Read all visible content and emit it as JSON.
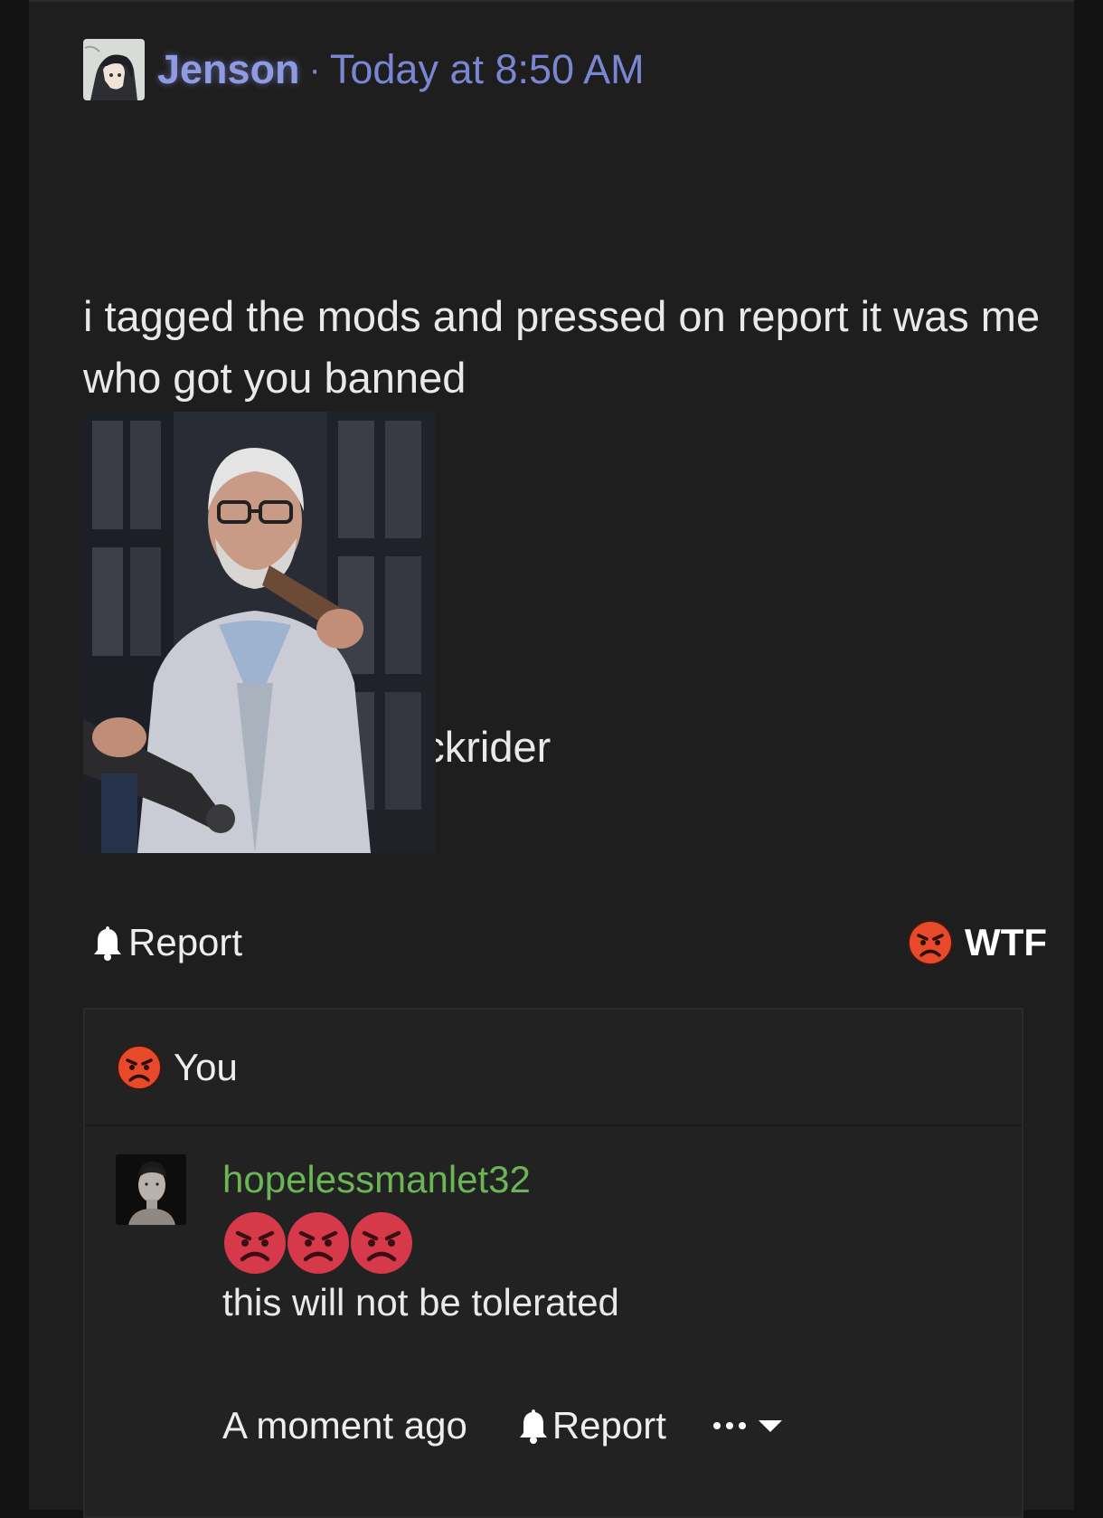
{
  "post": {
    "author": "Jenson",
    "separator": "·",
    "timestamp": "Today at 8:50 AM",
    "body_line1": "i tagged the mods and pressed on report it was me who got you banned",
    "body_line2": "-1 afroheadluke dickrider",
    "avatar_icon": "anime-avatar",
    "image": "gif-man-with-cigar",
    "actions": {
      "report_label": "Report",
      "reaction_label": "WTF",
      "reaction_icon": "angry-face-icon"
    }
  },
  "comments": {
    "reaction_summary_label": "You",
    "items": [
      {
        "author": "hopelessmanlet32",
        "avatar_icon": "profile-photo",
        "emoji_icons": [
          "pouting-face-icon",
          "pouting-face-icon",
          "pouting-face-icon"
        ],
        "text": "this will not be tolerated",
        "time": "A moment ago",
        "report_label": "Report",
        "more_icon": "ellipsis-icon",
        "dropdown_icon": "caret-down-icon"
      }
    ]
  },
  "colors": {
    "page_bg": "#121212",
    "card_bg": "#1e1e1f",
    "comment_bg": "#222223",
    "username": "#8f9be0",
    "timestamp": "#7a86d2",
    "comment_author": "#6bb554",
    "angry_orange": "#e8492b",
    "pouting_red": "#d63a4a",
    "text": "#e9e9e9"
  }
}
